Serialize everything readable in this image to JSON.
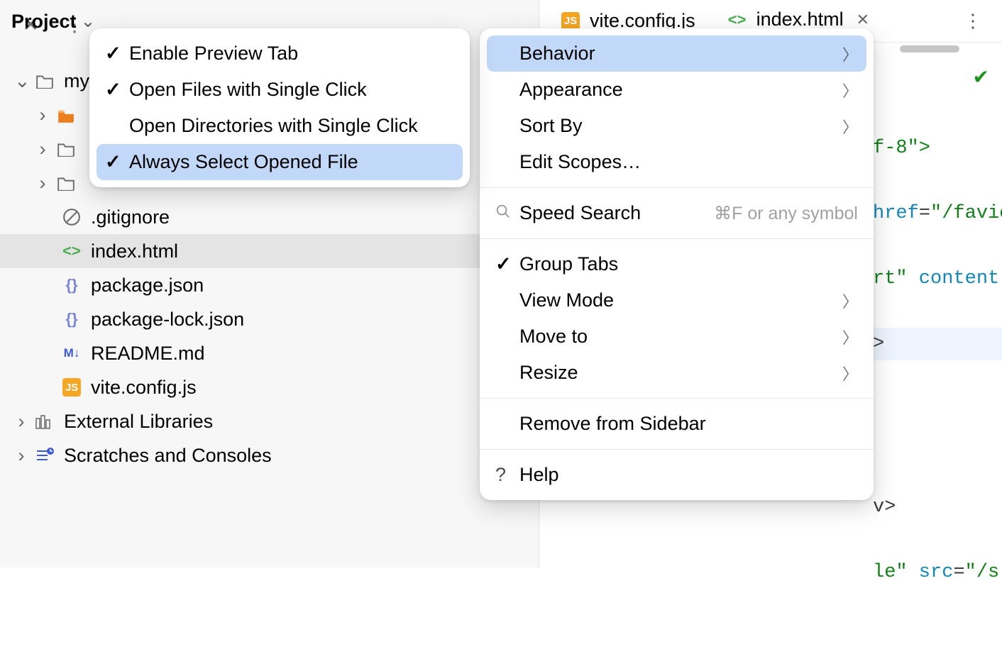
{
  "sidebar": {
    "title": "Project",
    "tree": {
      "root_label": "my",
      "folders": [
        "",
        "",
        ""
      ],
      "files": {
        "gitignore": ".gitignore",
        "index_html": "index.html",
        "package_json": "package.json",
        "package_lock": "package-lock.json",
        "readme": "README.md",
        "vite_config": "vite.config.js"
      },
      "external_libraries": "External Libraries",
      "scratches": "Scratches and Consoles"
    }
  },
  "tabs": {
    "tab1": "vite.config.js",
    "tab2": "index.html"
  },
  "code": {
    "l1": "f-8\">",
    "l2_attr": "href",
    "l2_str": "\"/favic",
    "l3_attr": "rt\"",
    "l3_attr2": " content",
    "l4": ">",
    "l5": "v>",
    "l6_attr": "le\"",
    "l6_attr2": " src",
    "l6_str": "\"/s"
  },
  "menu_main": {
    "behavior": "Behavior",
    "appearance": "Appearance",
    "sort_by": "Sort By",
    "edit_scopes": "Edit Scopes…",
    "speed_search": "Speed Search",
    "speed_shortcut": "⌘F or any symbol",
    "group_tabs": "Group Tabs",
    "view_mode": "View Mode",
    "move_to": "Move to",
    "resize": "Resize",
    "remove": "Remove from Sidebar",
    "help": "Help"
  },
  "menu_sub": {
    "enable_preview": "Enable Preview Tab",
    "open_files": "Open Files with Single Click",
    "open_dirs": "Open Directories with Single Click",
    "always_select": "Always Select Opened File"
  }
}
